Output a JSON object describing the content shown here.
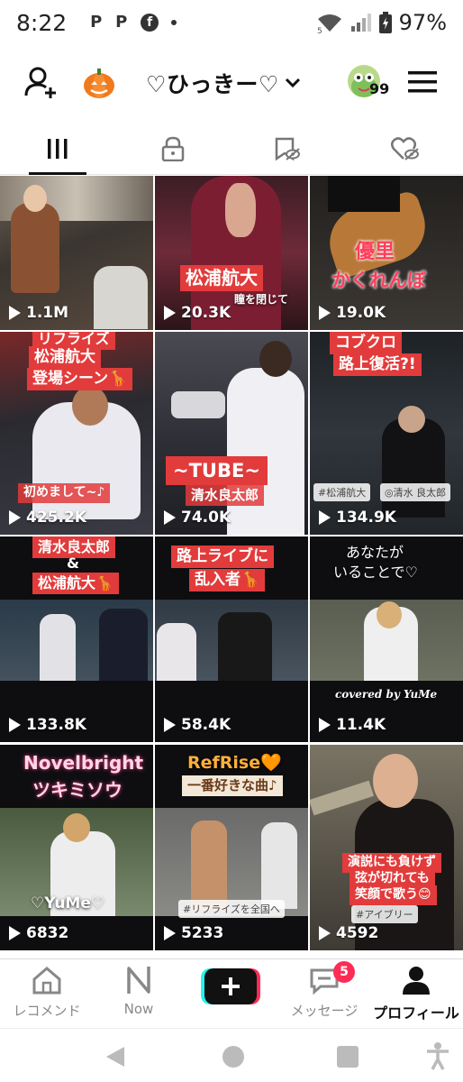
{
  "status_bar": {
    "time": "8:22",
    "notifications": [
      "P",
      "P",
      "f"
    ],
    "network": "5",
    "battery_pct": "97%"
  },
  "header": {
    "username": "♡ひっきー♡",
    "avatar_badge": "99",
    "icons": [
      "add-user-icon",
      "pumpkin-icon",
      "chevron-down-icon",
      "avatar",
      "hamburger-menu-icon"
    ]
  },
  "tabs": [
    {
      "name": "videos",
      "icon": "grid-icon",
      "active": true
    },
    {
      "name": "private",
      "icon": "lock-icon",
      "active": false
    },
    {
      "name": "favorites",
      "icon": "bookmark-hidden-icon",
      "active": false
    },
    {
      "name": "liked",
      "icon": "heart-hidden-icon",
      "active": false
    }
  ],
  "videos": [
    {
      "views": "1.1M",
      "caption_lines": []
    },
    {
      "views": "20.3K",
      "caption_lines": [
        "松浦航大",
        "瞳を閉じて"
      ]
    },
    {
      "views": "19.0K",
      "caption_lines": [
        "優里",
        "かくれんぼ"
      ]
    },
    {
      "views": "425.2K",
      "caption_lines": [
        "リフライズ",
        "松浦航大",
        "登場シーン🦒",
        "初めまして~♪"
      ]
    },
    {
      "views": "74.0K",
      "caption_lines": [
        "~TUBE~",
        "清水良太郎"
      ]
    },
    {
      "views": "134.9K",
      "caption_lines": [
        "コブクロ",
        "路上復活?!",
        "#松浦航大",
        "◎清水 良太郎"
      ]
    },
    {
      "views": "133.8K",
      "caption_lines": [
        "清水良太郎",
        "&",
        "松浦航大🦒"
      ]
    },
    {
      "views": "58.4K",
      "caption_lines": [
        "路上ライブに",
        "乱入者🦒"
      ]
    },
    {
      "views": "11.4K",
      "caption_lines": [
        "あなたが",
        "いることで♡",
        "covered by YuMe"
      ]
    },
    {
      "views": "6832",
      "caption_lines": [
        "Novelbright",
        "ツキミソウ",
        "♡YuMe♡"
      ]
    },
    {
      "views": "5233",
      "caption_lines": [
        "RefRise🧡",
        "一番好きな曲♪",
        "#リフライズを全国へ"
      ]
    },
    {
      "views": "4592",
      "caption_lines": [
        "演説にも負けず",
        "弦が切れても",
        "笑顔で歌う😊",
        "#アイブリー"
      ]
    }
  ],
  "bottom_nav": {
    "items": [
      {
        "label": "レコメンド",
        "icon": "home-icon"
      },
      {
        "label": "Now",
        "icon": "now-icon"
      },
      {
        "label": "",
        "icon": "create-plus-icon"
      },
      {
        "label": "メッセージ",
        "icon": "inbox-icon",
        "badge": "5"
      },
      {
        "label": "プロフィール",
        "icon": "profile-icon",
        "active": true
      }
    ]
  },
  "colors": {
    "accent_red": "#fe2c55",
    "caption_red": "#e23b3b",
    "create_cyan": "#25f4ee"
  }
}
